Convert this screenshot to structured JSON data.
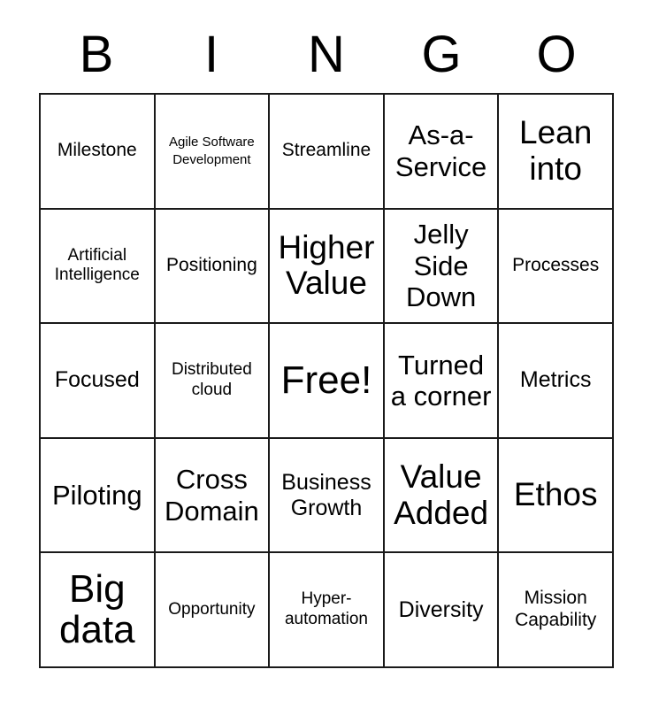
{
  "card": {
    "title": "BINGO Card",
    "header_letters": [
      "B",
      "I",
      "N",
      "G",
      "O"
    ],
    "columns": 5,
    "rows": 5,
    "colors": {
      "background": "#ffffff",
      "text": "#000000",
      "grid_line": "#1a1a1a"
    },
    "cells": [
      [
        {
          "text": "Milestone",
          "size": "sm"
        },
        {
          "text": "Agile Software Development",
          "size": "xxs"
        },
        {
          "text": "Streamline",
          "size": "sm"
        },
        {
          "text": "As-a-Service",
          "size": "lg"
        },
        {
          "text": "Lean into",
          "size": "xl"
        }
      ],
      [
        {
          "text": "Artificial Intelligence",
          "size": "xs"
        },
        {
          "text": "Positioning",
          "size": "sm"
        },
        {
          "text": "Higher Value",
          "size": "xl"
        },
        {
          "text": "Jelly Side Down",
          "size": "lg"
        },
        {
          "text": "Processes",
          "size": "sm"
        }
      ],
      [
        {
          "text": "Focused",
          "size": "md"
        },
        {
          "text": "Distributed cloud",
          "size": "xs"
        },
        {
          "text": "Free!",
          "size": "xxl"
        },
        {
          "text": "Turned a corner",
          "size": "lg"
        },
        {
          "text": "Metrics",
          "size": "md"
        }
      ],
      [
        {
          "text": "Piloting",
          "size": "lg"
        },
        {
          "text": "Cross Domain",
          "size": "lg"
        },
        {
          "text": "Business Growth",
          "size": "md"
        },
        {
          "text": "Value Added",
          "size": "xl"
        },
        {
          "text": "Ethos",
          "size": "xl"
        }
      ],
      [
        {
          "text": "Big data",
          "size": "xxl"
        },
        {
          "text": "Opportunity",
          "size": "xs"
        },
        {
          "text": "Hyper-automation",
          "size": "xs"
        },
        {
          "text": "Diversity",
          "size": "md"
        },
        {
          "text": "Mission Capability",
          "size": "sm"
        }
      ]
    ]
  }
}
